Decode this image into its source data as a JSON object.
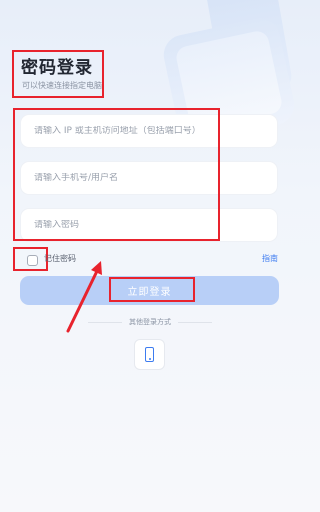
{
  "login": {
    "title": "密码登录",
    "subtitle": "可以快速连接指定电脑",
    "fields": [
      {
        "placeholder": "请输入 IP 或主机访问地址（包括端口号）",
        "value": ""
      },
      {
        "placeholder": "请输入手机号/用户名",
        "value": ""
      },
      {
        "placeholder": "请输入密码",
        "value": ""
      }
    ],
    "remember_label": "记住密码",
    "remember_checked": false,
    "guide_link": "指南",
    "login_button": "立即登录",
    "other_methods_label": "其他登录方式",
    "other_method_icon": "phone-icon"
  },
  "colors": {
    "accent": "#3d7cf0",
    "button_disabled": "#b8cff7",
    "annotation_red": "#e8232d"
  }
}
